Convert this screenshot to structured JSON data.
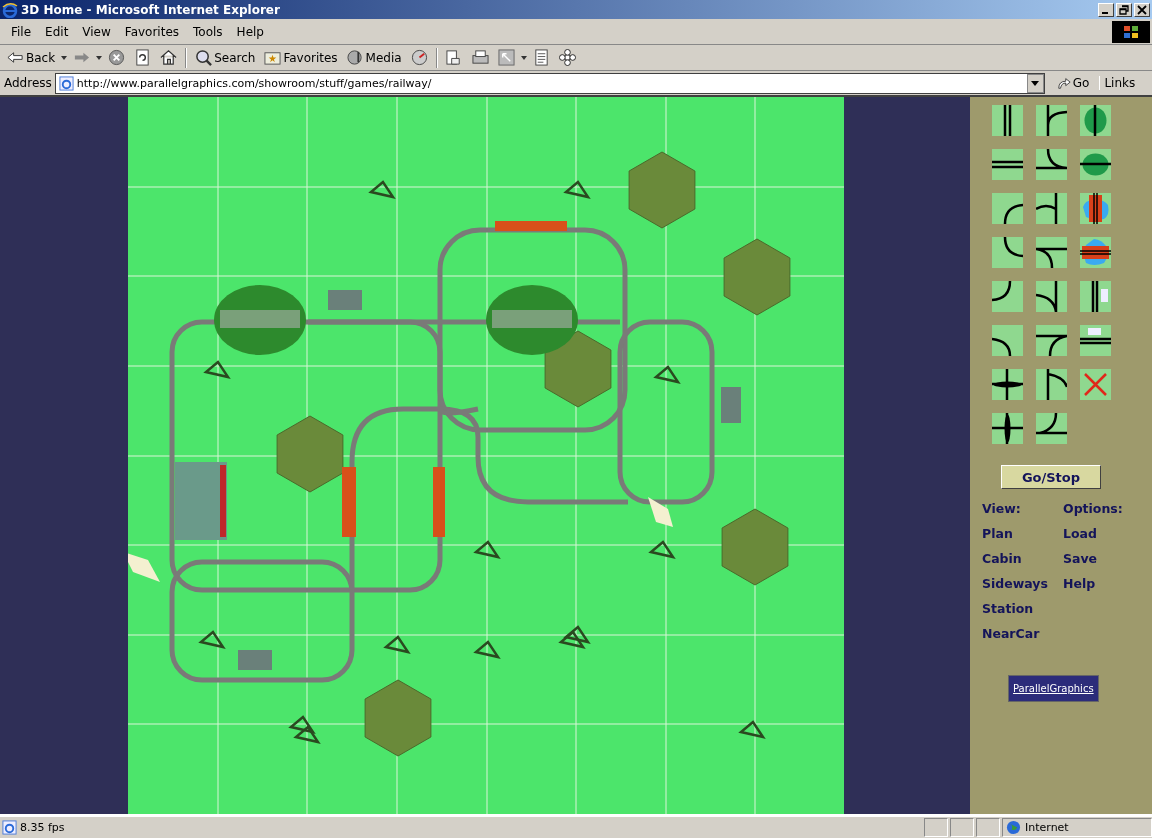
{
  "window": {
    "title": "3D Home - Microsoft Internet Explorer"
  },
  "menu": [
    "File",
    "Edit",
    "View",
    "Favorites",
    "Tools",
    "Help"
  ],
  "toolbar": [
    {
      "kind": "back",
      "label": "Back"
    },
    {
      "kind": "forward"
    },
    {
      "kind": "stop"
    },
    {
      "kind": "refresh"
    },
    {
      "kind": "home"
    },
    {
      "kind": "search",
      "label": "Search"
    },
    {
      "kind": "favorites",
      "label": "Favorites"
    },
    {
      "kind": "media",
      "label": "Media"
    },
    {
      "kind": "history"
    },
    {
      "kind": "mail"
    },
    {
      "kind": "print"
    },
    {
      "kind": "edit"
    },
    {
      "kind": "discuss"
    },
    {
      "kind": "messenger"
    }
  ],
  "address": {
    "label": "Address",
    "value": "http://www.parallelgraphics.com/showroom/stuff/games/railway/",
    "go": "Go",
    "links": "Links"
  },
  "panel": {
    "button": "Go/Stop",
    "view": {
      "heading": "View:",
      "items": [
        "Plan",
        "Cabin",
        "Sideways",
        "Station",
        "NearCar"
      ]
    },
    "options": {
      "heading": "Options:",
      "items": [
        "Load",
        "Save",
        "Help"
      ]
    },
    "logo": "ParallelGraphics"
  },
  "status_bar": {
    "text": "8.35 fps",
    "zone": "Internet"
  }
}
